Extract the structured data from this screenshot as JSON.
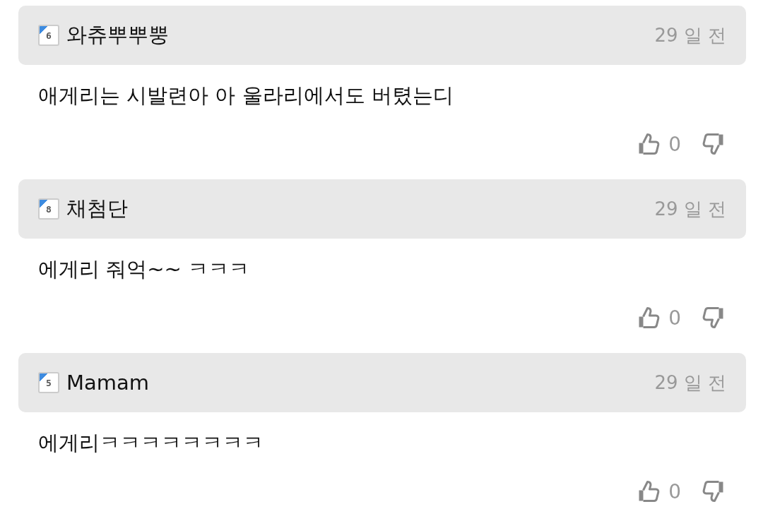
{
  "comments": [
    {
      "level": "6",
      "author": "와츄뿌뿌뿡",
      "time": "29 일 전",
      "text": "애게리는 시발련아 아 울라리에서도 버텼는디",
      "likes": "0"
    },
    {
      "level": "8",
      "author": "채첨단",
      "time": "29 일 전",
      "text": "에게리 줘억~~ ㅋㅋㅋ",
      "likes": "0"
    },
    {
      "level": "5",
      "author": "Mamam",
      "time": "29 일 전",
      "text": "에게리ㅋㅋㅋㅋㅋㅋㅋㅋ",
      "likes": "0"
    }
  ]
}
